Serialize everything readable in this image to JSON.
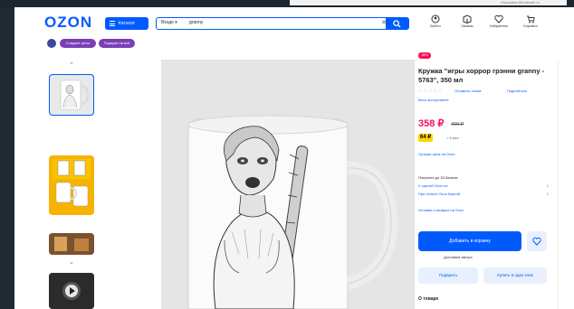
{
  "ad_strip": {
    "text": "Московия Wholesale.ru"
  },
  "header": {
    "logo": "OZON",
    "catalog_label": "Каталог",
    "search_scope": "Везде ▾",
    "search_query": "granny",
    "icons": [
      {
        "name": "login-icon",
        "label": "Войти"
      },
      {
        "name": "orders-icon",
        "label": "Заказы"
      },
      {
        "name": "favorites-icon",
        "label": "Избранное"
      },
      {
        "name": "cart-icon",
        "label": "Корзина"
      }
    ]
  },
  "chips": [
    "Сладкие цены",
    "Подарки на всё"
  ],
  "product": {
    "badge": "-55%",
    "title": "Кружка \"игры хоррор грэнни granny - 5763\", 350 мл",
    "rating_stars": "☆☆☆☆☆",
    "reviews": "Оставить отзыв",
    "share": "Поделиться",
    "related": "Весь ассортимент",
    "price": "358 ₽",
    "old_price": "799 ₽",
    "card_price": "64 ₽",
    "card_label": "• 6 мес",
    "price_link": "Лучшая цена на Ozon",
    "seller_lines": [
      {
        "text": "Получите до 20 баллов",
        "n": ""
      },
      {
        "text": "С картой Ozon по",
        "n": "1"
      },
      {
        "text": "При оплате Ozon Картой",
        "n": "1"
      }
    ],
    "terms": "Условия и возврат на Ozon",
    "cart_button": "Добавить в корзину",
    "delivery": "Доставим завтра",
    "gift_button": "Подарить",
    "oneclick_button": "Купить в один клик",
    "about": "О товаре"
  },
  "colors": {
    "accent": "#005bff",
    "price": "#f91155",
    "card": "#ffd500"
  }
}
